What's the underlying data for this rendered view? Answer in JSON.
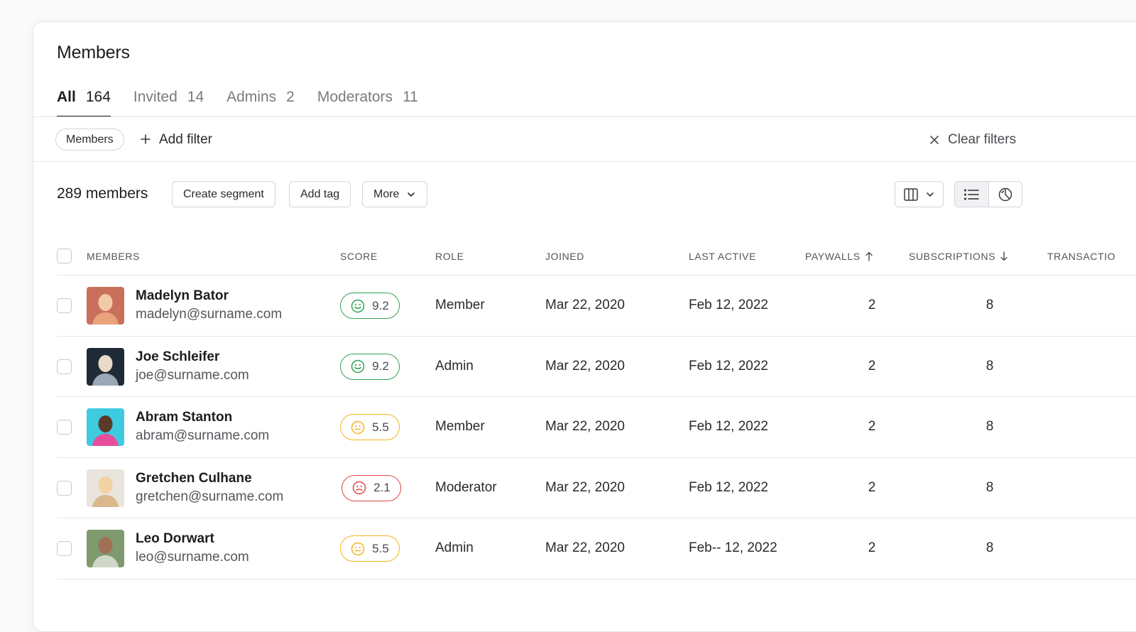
{
  "page": {
    "title": "Members"
  },
  "tabs": [
    {
      "label": "All",
      "count": "164",
      "active": true
    },
    {
      "label": "Invited",
      "count": "14",
      "active": false
    },
    {
      "label": "Admins",
      "count": "2",
      "active": false
    },
    {
      "label": "Moderators",
      "count": "11",
      "active": false
    }
  ],
  "filters": {
    "chip_label": "Members",
    "add_filter_label": "Add filter",
    "clear_filters_label": "Clear filters"
  },
  "toolbar": {
    "member_count": "289 members",
    "create_segment_label": "Create segment",
    "add_tag_label": "Add tag",
    "more_label": "More"
  },
  "table": {
    "columns": {
      "members": "MEMBERS",
      "score": "SCORE",
      "role": "ROLE",
      "joined": "JOINED",
      "last_active": "LAST ACTIVE",
      "paywalls": "PAYWALLS",
      "subscriptions": "SUBSCRIPTIONS",
      "transactions": "TRANSACTIO"
    },
    "rows": [
      {
        "name": "Madelyn Bator",
        "email": "madelyn@surname.com",
        "score": "9.2",
        "score_level": "good",
        "role": "Member",
        "joined": "Mar 22, 2020",
        "last_active": "Feb 12, 2022",
        "paywalls": "2",
        "subscriptions": "8"
      },
      {
        "name": "Joe Schleifer",
        "email": "joe@surname.com",
        "score": "9.2",
        "score_level": "good",
        "role": "Admin",
        "joined": "Mar 22, 2020",
        "last_active": "Feb 12, 2022",
        "paywalls": "2",
        "subscriptions": "8"
      },
      {
        "name": "Abram Stanton",
        "email": "abram@surname.com",
        "score": "5.5",
        "score_level": "mid",
        "role": "Member",
        "joined": "Mar 22, 2020",
        "last_active": "Feb 12, 2022",
        "paywalls": "2",
        "subscriptions": "8"
      },
      {
        "name": "Gretchen Culhane",
        "email": "gretchen@surname.com",
        "score": "2.1",
        "score_level": "bad",
        "role": "Moderator",
        "joined": "Mar 22, 2020",
        "last_active": "Feb 12, 2022",
        "paywalls": "2",
        "subscriptions": "8"
      },
      {
        "name": "Leo Dorwart",
        "email": "leo@surname.com",
        "score": "5.5",
        "score_level": "mid",
        "role": "Admin",
        "joined": "Mar 22, 2020",
        "last_active": "Feb-- 12, 2022",
        "paywalls": "2",
        "subscriptions": "8"
      }
    ]
  },
  "colors": {
    "score_good": "#2fa353",
    "score_mid": "#f2b51d",
    "score_bad": "#e04848",
    "text_primary": "#1d1d1f",
    "border": "#d5d5da"
  },
  "icons": {
    "add_filter": "plus-icon",
    "clear_filters": "close-icon",
    "more": "chevron-down-icon",
    "columns": "columns-icon",
    "list_view": "list-icon",
    "chart_view": "pie-chart-icon",
    "paywalls_sort": "arrow-up-icon",
    "subscriptions_sort": "arrow-down-icon"
  }
}
